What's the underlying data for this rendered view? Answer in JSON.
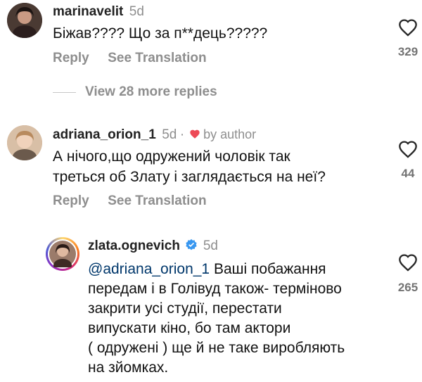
{
  "comments": [
    {
      "username": "marinavelit",
      "time": "5d",
      "text": "Біжав???? Що за п**дець?????",
      "reply_label": "Reply",
      "translate_label": "See Translation",
      "likes": "329"
    },
    {
      "username": "adriana_orion_1",
      "time": "5d",
      "separator": "·",
      "liked_by": "by author",
      "text_line1": "А нічого,що одружений чоловік так",
      "text_line2": "треться об Злату і заглядається на неї?",
      "reply_label": "Reply",
      "translate_label": "See Translation",
      "likes": "44"
    }
  ],
  "view_more_replies": "View 28 more replies",
  "reply": {
    "username": "zlata.ognevich",
    "time": "5d",
    "mention": "@adriana_orion_1",
    "line1_rest": " Ваші побажання",
    "line2": "передам і в Голівуд також- терміново",
    "line3": "закрити усі студії, перестати",
    "line4": "випускати кіно, бо там актори",
    "line5": "( одружені ) ще й не таке виробляють",
    "line6": "на зйомках.",
    "likes": "265"
  },
  "colors": {
    "verified": "#3897f0",
    "author_heart": "#ed4956",
    "secondary_text": "#8e8e8e",
    "mention": "#00376b"
  }
}
